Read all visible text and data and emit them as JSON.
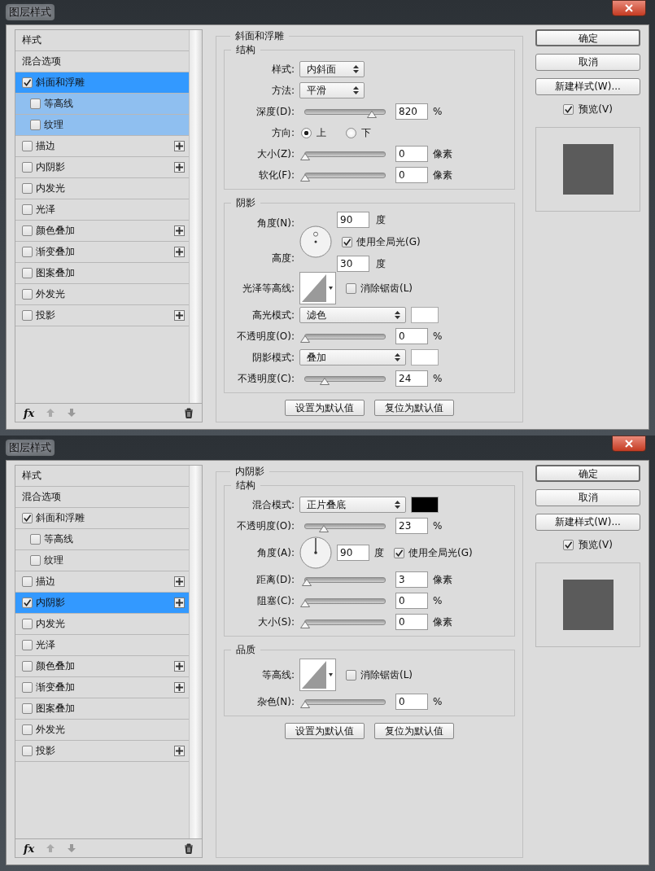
{
  "dialogs": [
    {
      "title": "图层样式",
      "styles": [
        {
          "label": "样式",
          "kind": "header",
          "selected": false
        },
        {
          "label": "混合选项",
          "kind": "header",
          "selected": false
        },
        {
          "label": "斜面和浮雕",
          "kind": "effect",
          "checked": true,
          "selected": true,
          "add": false,
          "children": [
            {
              "label": "等高线",
              "kind": "effect",
              "checked": false,
              "selected": false,
              "add": false
            },
            {
              "label": "纹理",
              "kind": "effect",
              "checked": false,
              "selected": false,
              "add": false
            }
          ]
        },
        {
          "label": "描边",
          "kind": "effect",
          "checked": false,
          "selected": false,
          "add": true
        },
        {
          "label": "内阴影",
          "kind": "effect",
          "checked": false,
          "selected": false,
          "add": true
        },
        {
          "label": "内发光",
          "kind": "effect",
          "checked": false,
          "selected": false,
          "add": false
        },
        {
          "label": "光泽",
          "kind": "effect",
          "checked": false,
          "selected": false,
          "add": false
        },
        {
          "label": "颜色叠加",
          "kind": "effect",
          "checked": false,
          "selected": false,
          "add": true
        },
        {
          "label": "渐变叠加",
          "kind": "effect",
          "checked": false,
          "selected": false,
          "add": true
        },
        {
          "label": "图案叠加",
          "kind": "effect",
          "checked": false,
          "selected": false,
          "add": false
        },
        {
          "label": "外发光",
          "kind": "effect",
          "checked": false,
          "selected": false,
          "add": false
        },
        {
          "label": "投影",
          "kind": "effect",
          "checked": false,
          "selected": false,
          "add": true
        }
      ],
      "footer": {
        "fx": "fx"
      },
      "panel": {
        "title": "斜面和浮雕",
        "sections": [
          {
            "title": "结构",
            "rows": [
              {
                "kind": "select",
                "label": "样式:",
                "value": "内斜面"
              },
              {
                "kind": "select",
                "label": "方法:",
                "value": "平滑"
              },
              {
                "kind": "slider",
                "label": "深度(D):",
                "level": 0.84,
                "value": "820",
                "unit": "%"
              },
              {
                "kind": "radio",
                "label": "方向:",
                "options": [
                  {
                    "label": "上",
                    "selected": true
                  },
                  {
                    "label": "下",
                    "selected": false
                  }
                ]
              },
              {
                "kind": "slider",
                "label": "大小(Z):",
                "level": 0,
                "value": "0",
                "unit": "像素"
              },
              {
                "kind": "slider",
                "label": "软化(F):",
                "level": 0,
                "value": "0",
                "unit": "像素"
              }
            ]
          },
          {
            "title": "阴影",
            "rows": [
              {
                "kind": "angle",
                "label": "角度(N):",
                "value": "90",
                "unit": "度",
                "global": {
                  "label": "使用全局光(G)",
                  "checked": true
                },
                "altitude": {
                  "label": "高度:",
                  "value": "30",
                  "unit": "度"
                }
              },
              {
                "kind": "contour",
                "label": "光泽等高线:",
                "antialias": {
                  "label": "消除锯齿(L)",
                  "checked": false
                }
              },
              {
                "kind": "select",
                "label": "高光模式:",
                "value": "滤色",
                "color": "#ffffff"
              },
              {
                "kind": "slider",
                "label": "不透明度(O):",
                "level": 0,
                "value": "0",
                "unit": "%"
              },
              {
                "kind": "select",
                "label": "阴影模式:",
                "value": "叠加",
                "color": "#ffffff"
              },
              {
                "kind": "slider",
                "label": "不透明度(C):",
                "level": 0.24,
                "value": "24",
                "unit": "%"
              }
            ]
          }
        ],
        "buttons": [
          "设置为默认值",
          "复位为默认值"
        ]
      },
      "actions": [
        {
          "label": "确定",
          "default": true
        },
        {
          "label": "取消",
          "default": false
        },
        {
          "label": "新建样式(W)...",
          "default": false
        }
      ],
      "preview": {
        "label": "预览(V)",
        "checked": true
      }
    },
    {
      "title": "图层样式",
      "styles": [
        {
          "label": "样式",
          "kind": "header",
          "selected": false
        },
        {
          "label": "混合选项",
          "kind": "header",
          "selected": false
        },
        {
          "label": "斜面和浮雕",
          "kind": "effect",
          "checked": true,
          "selected": false,
          "add": false,
          "children": [
            {
              "label": "等高线",
              "kind": "effect",
              "checked": false,
              "selected": false,
              "add": false
            },
            {
              "label": "纹理",
              "kind": "effect",
              "checked": false,
              "selected": false,
              "add": false
            }
          ]
        },
        {
          "label": "描边",
          "kind": "effect",
          "checked": false,
          "selected": false,
          "add": true
        },
        {
          "label": "内阴影",
          "kind": "effect",
          "checked": true,
          "selected": true,
          "add": true
        },
        {
          "label": "内发光",
          "kind": "effect",
          "checked": false,
          "selected": false,
          "add": false
        },
        {
          "label": "光泽",
          "kind": "effect",
          "checked": false,
          "selected": false,
          "add": false
        },
        {
          "label": "颜色叠加",
          "kind": "effect",
          "checked": false,
          "selected": false,
          "add": true
        },
        {
          "label": "渐变叠加",
          "kind": "effect",
          "checked": false,
          "selected": false,
          "add": true
        },
        {
          "label": "图案叠加",
          "kind": "effect",
          "checked": false,
          "selected": false,
          "add": false
        },
        {
          "label": "外发光",
          "kind": "effect",
          "checked": false,
          "selected": false,
          "add": false
        },
        {
          "label": "投影",
          "kind": "effect",
          "checked": false,
          "selected": false,
          "add": true
        }
      ],
      "footer": {
        "fx": "fx"
      },
      "panel": {
        "title": "内阴影",
        "sections": [
          {
            "title": "结构",
            "rows": [
              {
                "kind": "select",
                "label": "混合模式:",
                "value": "正片叠底",
                "color": "#000000"
              },
              {
                "kind": "slider",
                "label": "不透明度(O):",
                "level": 0.23,
                "value": "23",
                "unit": "%"
              },
              {
                "kind": "angle",
                "label": "角度(A):",
                "value": "90",
                "unit": "度",
                "global": {
                  "label": "使用全局光(G)",
                  "checked": true
                }
              },
              {
                "kind": "slider",
                "label": "距离(D):",
                "level": 0.02,
                "value": "3",
                "unit": "像素"
              },
              {
                "kind": "slider",
                "label": "阻塞(C):",
                "level": 0,
                "value": "0",
                "unit": "%"
              },
              {
                "kind": "slider",
                "label": "大小(S):",
                "level": 0,
                "value": "0",
                "unit": "像素"
              }
            ]
          },
          {
            "title": "品质",
            "rows": [
              {
                "kind": "contour",
                "label": "等高线:",
                "antialias": {
                  "label": "消除锯齿(L)",
                  "checked": false
                }
              },
              {
                "kind": "slider",
                "label": "杂色(N):",
                "level": 0,
                "value": "0",
                "unit": "%"
              }
            ]
          }
        ],
        "buttons": [
          "设置为默认值",
          "复位为默认值"
        ]
      },
      "actions": [
        {
          "label": "确定",
          "default": true
        },
        {
          "label": "取消",
          "default": false
        },
        {
          "label": "新建样式(W)...",
          "default": false
        }
      ],
      "preview": {
        "label": "预览(V)",
        "checked": true
      }
    }
  ]
}
